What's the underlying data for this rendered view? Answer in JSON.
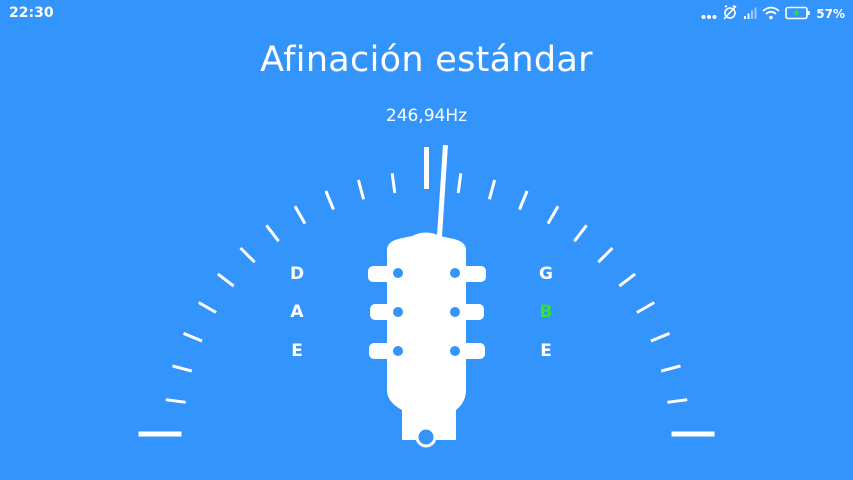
{
  "status_bar": {
    "time": "22:30",
    "battery_percent": "57%",
    "icons": [
      "more-dots-icon",
      "alarm-off-icon",
      "signal-icon",
      "wifi-icon",
      "battery-charging-icon"
    ]
  },
  "tuning": {
    "title": "Afinación estándar",
    "frequency": "246,94Hz"
  },
  "strings": {
    "left": [
      "D",
      "A",
      "E"
    ],
    "right": [
      "G",
      "B",
      "E"
    ],
    "selected": "B"
  },
  "gauge": {
    "needle_offset": 0.5
  },
  "colors": {
    "background": "#3394fb",
    "foreground": "#ffffff",
    "active_string": "#2fe33c"
  }
}
